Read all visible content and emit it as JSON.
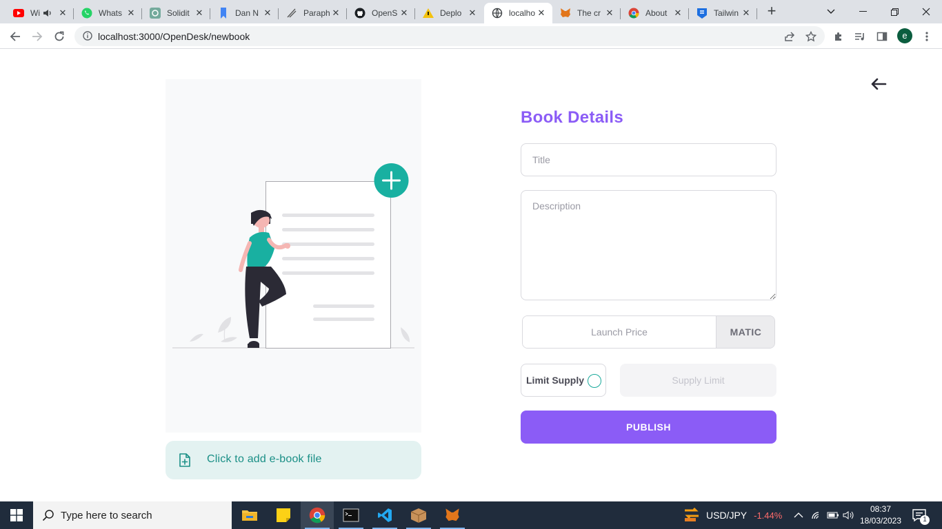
{
  "browser": {
    "tabs": [
      {
        "title": "Wi",
        "favicon": "youtube-icon",
        "audio": true
      },
      {
        "title": "Whats",
        "favicon": "whatsapp-icon"
      },
      {
        "title": "Solidit",
        "favicon": "openai-icon"
      },
      {
        "title": "Dan N",
        "favicon": "bookmark-icon"
      },
      {
        "title": "Paraph",
        "favicon": "quill-icon"
      },
      {
        "title": "OpenS",
        "favicon": "github-icon"
      },
      {
        "title": "Deplo",
        "favicon": "warning-icon"
      },
      {
        "title": "localho",
        "favicon": "globe-icon",
        "active": true
      },
      {
        "title": "The cr",
        "favicon": "metamask-icon"
      },
      {
        "title": "About",
        "favicon": "chrome-icon"
      },
      {
        "title": "Tailwin",
        "favicon": "shield-icon"
      }
    ],
    "url": "localhost:3000/OpenDesk/newbook",
    "profile_initial": "e"
  },
  "page": {
    "heading": "Book Details",
    "title_placeholder": "Title",
    "description_placeholder": "Description",
    "price_placeholder": "Launch Price",
    "currency": "MATIC",
    "limit_supply_label": "Limit Supply",
    "limit_supply_checked": false,
    "supply_limit_placeholder": "Supply Limit",
    "publish_label": "PUBLISH",
    "upload_label": "Click to add e-book file"
  },
  "colors": {
    "accent": "#8b5cf6",
    "teal": "#19b0a1",
    "upload_bg": "#e3f2f1"
  },
  "taskbar": {
    "search_placeholder": "Type here to search",
    "ticker_symbol": "USD/JPY",
    "ticker_change": "-1.44%",
    "time": "08:37",
    "date": "18/03/2023",
    "notification_count": "1"
  }
}
